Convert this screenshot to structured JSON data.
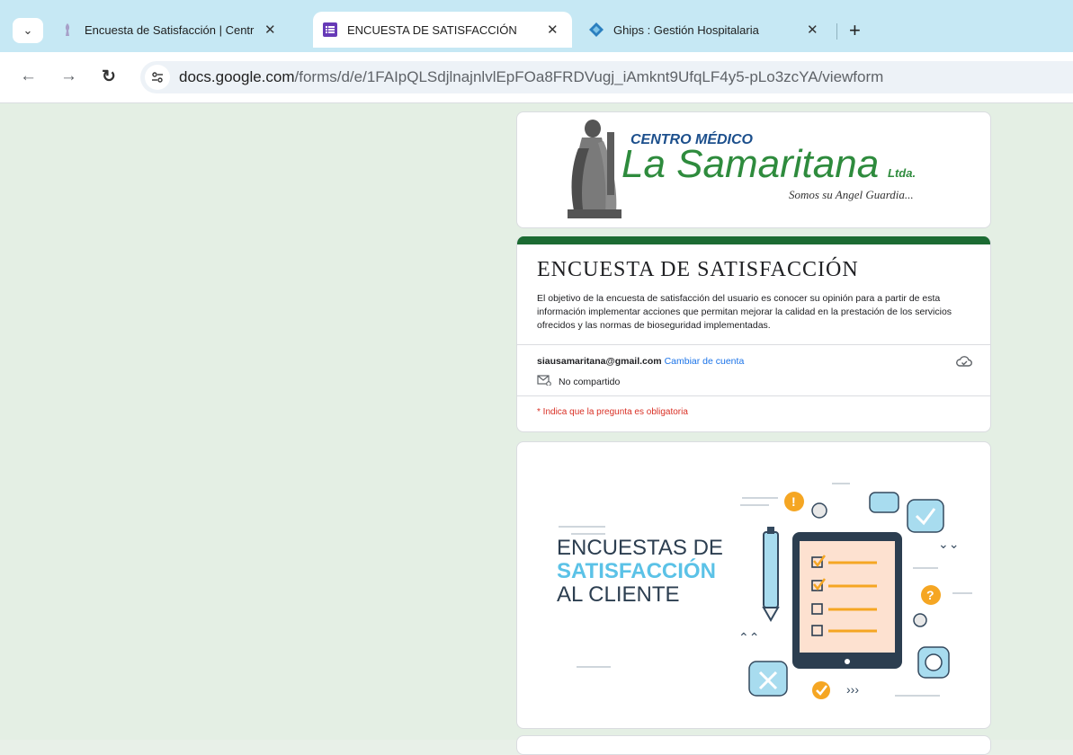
{
  "browser": {
    "tabs": [
      {
        "title": "Encuesta de Satisfacción | Centr",
        "close": "✕"
      },
      {
        "title": "ENCUESTA DE SATISFACCIÓN",
        "close": "✕"
      },
      {
        "title": "Ghips : Gestión Hospitalaria",
        "close": "✕"
      }
    ],
    "new_tab": "+",
    "url_host": "docs.google.com",
    "url_path": "/forms/d/e/1FAIpQLSdjlnajnlvlEpFOa8FRDVugj_iAmknt9UfqLF4y5-pLo3zcYA/viewform"
  },
  "logo": {
    "line1": "CENTRO MÉDICO",
    "line2": "La Samaritana",
    "suffix": "Ltda.",
    "tagline": "Somos su Angel Guardia..."
  },
  "form": {
    "title": "ENCUESTA DE SATISFACCIÓN",
    "description": "El objetivo de la encuesta de satisfacción del usuario es conocer su opinión para a partir de esta información implementar acciones que permitan mejorar la calidad en la prestación de los servicios ofrecidos y las normas de bioseguridad implementadas.",
    "account_email": "siausamaritana@gmail.com",
    "switch_account": "Cambiar de cuenta",
    "not_shared": "No compartido",
    "required_note": "* Indica que la pregunta es obligatoria"
  },
  "banner": {
    "line1": "ENCUESTAS DE",
    "line2": "SATISFACCIÓN",
    "line3": "AL CLIENTE"
  },
  "colors": {
    "theme_green": "#1c6b33",
    "page_background": "#e4efe4",
    "tabstrip": "#c6e8f4",
    "link_blue": "#1a73e8",
    "required_red": "#d93025"
  }
}
